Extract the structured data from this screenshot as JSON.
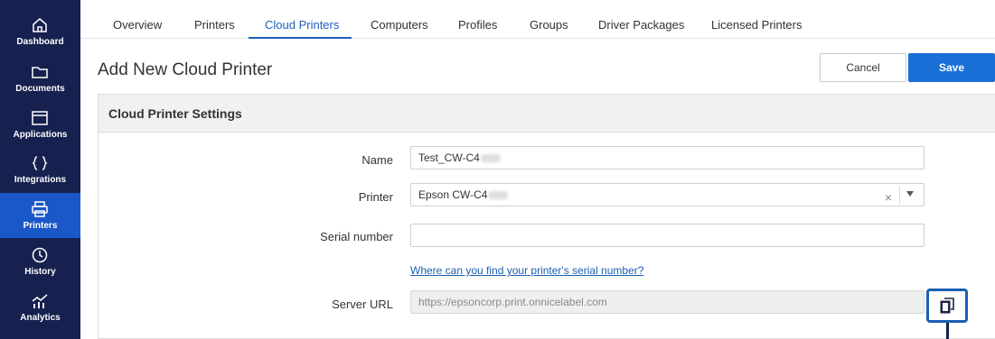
{
  "sidebar": {
    "items": [
      {
        "label": "Dashboard",
        "icon": "home-icon",
        "active": false
      },
      {
        "label": "Documents",
        "icon": "folder-icon",
        "active": false
      },
      {
        "label": "Applications",
        "icon": "window-icon",
        "active": false
      },
      {
        "label": "Integrations",
        "icon": "braces-icon",
        "active": false
      },
      {
        "label": "Printers",
        "icon": "printer-icon",
        "active": true
      },
      {
        "label": "History",
        "icon": "history-icon",
        "active": false
      },
      {
        "label": "Analytics",
        "icon": "analytics-icon",
        "active": false
      }
    ]
  },
  "tabs": [
    {
      "label": "Overview"
    },
    {
      "label": "Printers"
    },
    {
      "label": "Cloud Printers",
      "active": true
    },
    {
      "label": "Computers"
    },
    {
      "label": "Profiles"
    },
    {
      "label": "Groups"
    },
    {
      "label": "Driver Packages"
    },
    {
      "label": "Licensed Printers"
    }
  ],
  "header": {
    "title": "Add New Cloud Printer",
    "cancel_label": "Cancel",
    "save_label": "Save"
  },
  "form": {
    "section_title": "Cloud Printer Settings",
    "name_label": "Name",
    "name_value": "Test_CW-C4",
    "printer_label": "Printer",
    "printer_value": "Epson CW-C4",
    "serial_label": "Serial number",
    "serial_value": "",
    "serial_help_link": "Where can you find your printer's serial number?",
    "server_url_label": "Server URL",
    "server_url_value": "https://epsoncorp.print.onnicelabel.com",
    "clear_symbol": "×"
  },
  "colors": {
    "sidebar_bg": "#16214f",
    "sidebar_active": "#1a57c8",
    "accent": "#1f5fbf",
    "save_button": "#1a6fd6"
  }
}
